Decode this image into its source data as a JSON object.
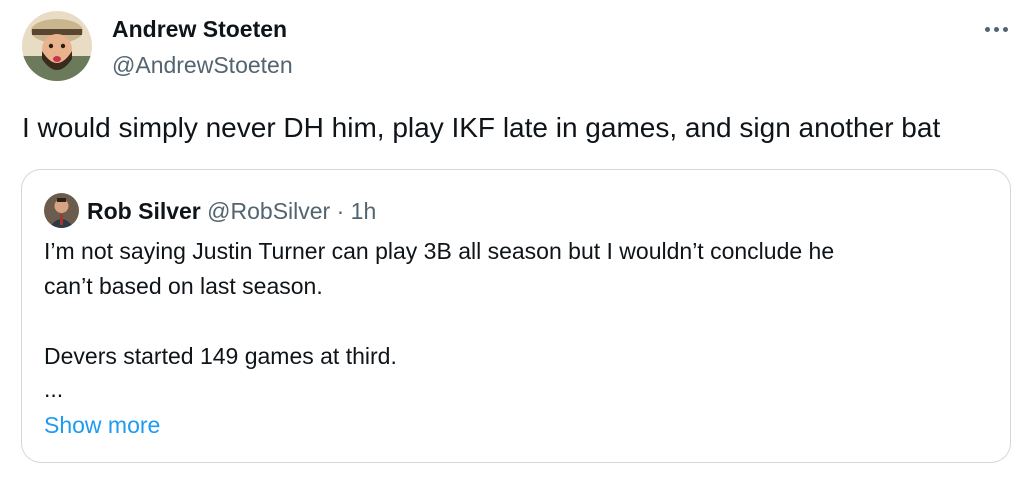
{
  "author": {
    "name": "Andrew Stoeten",
    "handle": "@AndrewStoeten"
  },
  "tweet": {
    "text": "I would simply never DH him, play IKF late in games, and sign another bat"
  },
  "quoted": {
    "name": "Rob Silver",
    "handle": "@RobSilver",
    "separator": "·",
    "time": "1h",
    "lines": [
      "I’m not saying Justin Turner can play 3B all season but I wouldn’t conclude he",
      "can’t based on last season.",
      "Devers started 149 games at third.",
      "..."
    ],
    "show_more": "Show more"
  },
  "colors": {
    "text": "#0f1419",
    "secondary": "#536471",
    "link": "#1d9bf0",
    "border": "#cfd9de"
  },
  "icons": {
    "more": "more-horizontal-icon"
  }
}
